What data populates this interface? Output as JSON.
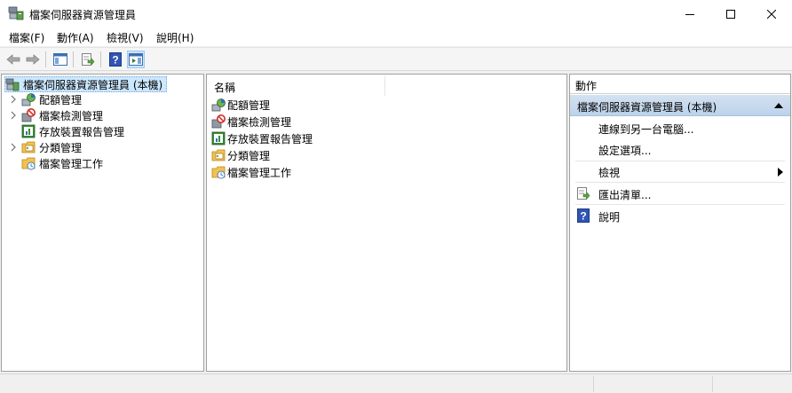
{
  "window": {
    "title": "檔案伺服器資源管理員"
  },
  "menu": [
    "檔案(F)",
    "動作(A)",
    "檢視(V)",
    "說明(H)"
  ],
  "tree": {
    "root": "檔案伺服器資源管理員 (本機)",
    "items": [
      {
        "label": "配額管理",
        "icon": "quota-icon",
        "expandable": true
      },
      {
        "label": "檔案檢測管理",
        "icon": "file-screen-icon",
        "expandable": true
      },
      {
        "label": "存放裝置報告管理",
        "icon": "storage-report-icon",
        "expandable": false
      },
      {
        "label": "分類管理",
        "icon": "classification-icon",
        "expandable": true
      },
      {
        "label": "檔案管理工作",
        "icon": "file-management-task-icon",
        "expandable": false
      }
    ]
  },
  "list": {
    "column": "名稱",
    "items": [
      {
        "label": "配額管理",
        "icon": "quota-icon"
      },
      {
        "label": "檔案檢測管理",
        "icon": "file-screen-icon"
      },
      {
        "label": "存放裝置報告管理",
        "icon": "storage-report-icon"
      },
      {
        "label": "分類管理",
        "icon": "classification-icon"
      },
      {
        "label": "檔案管理工作",
        "icon": "file-management-task-icon"
      }
    ]
  },
  "actions": {
    "title": "動作",
    "section": "檔案伺服器資源管理員 (本機)",
    "items": [
      {
        "label": "連線到另一台電腦..."
      },
      {
        "label": "設定選項..."
      },
      {
        "label": "檢視"
      },
      {
        "label": "匯出清單..."
      },
      {
        "label": "說明"
      }
    ]
  },
  "colors": {
    "selection": "#cce8ff",
    "action_header": "#c4d6ec",
    "help_blue": "#2f55b5"
  }
}
